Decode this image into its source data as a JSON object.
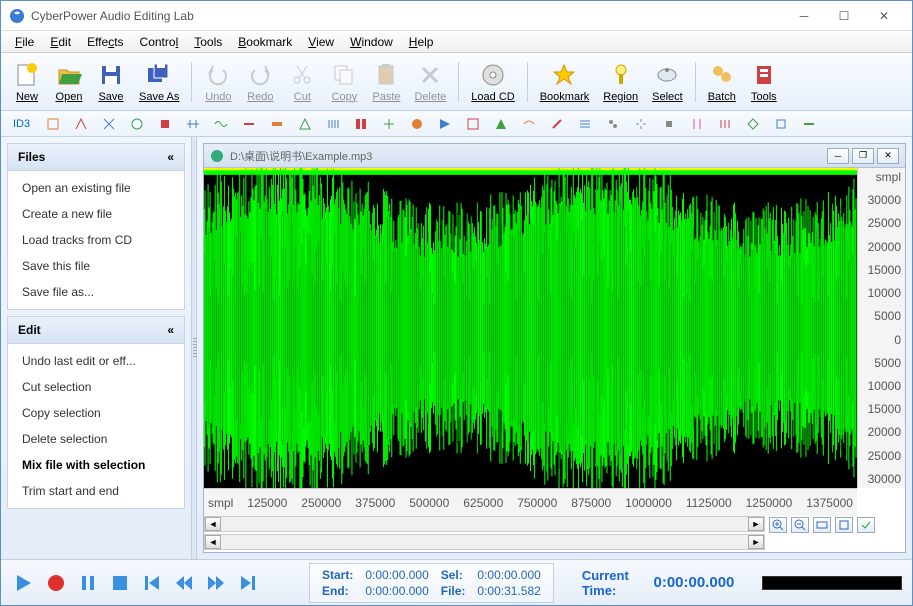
{
  "window": {
    "title": "CyberPower Audio Editing Lab"
  },
  "menu": {
    "items": [
      "File",
      "Edit",
      "Effects",
      "Control",
      "Tools",
      "Bookmark",
      "View",
      "Window",
      "Help"
    ]
  },
  "toolbar": [
    {
      "label": "New",
      "icon": "new",
      "enabled": true
    },
    {
      "label": "Open",
      "icon": "open",
      "enabled": true
    },
    {
      "label": "Save",
      "icon": "save",
      "enabled": true
    },
    {
      "label": "Save As",
      "icon": "saveas",
      "enabled": true
    },
    {
      "sep": true
    },
    {
      "label": "Undo",
      "icon": "undo",
      "enabled": false
    },
    {
      "label": "Redo",
      "icon": "redo",
      "enabled": false
    },
    {
      "label": "Cut",
      "icon": "cut",
      "enabled": false
    },
    {
      "label": "Copy",
      "icon": "copy",
      "enabled": false
    },
    {
      "label": "Paste",
      "icon": "paste",
      "enabled": false
    },
    {
      "label": "Delete",
      "icon": "delete",
      "enabled": false
    },
    {
      "sep": true
    },
    {
      "label": "Load CD",
      "icon": "cd",
      "enabled": true
    },
    {
      "sep": true
    },
    {
      "label": "Bookmark",
      "icon": "bookmark",
      "enabled": true
    },
    {
      "label": "Region",
      "icon": "region",
      "enabled": true
    },
    {
      "label": "Select",
      "icon": "select",
      "enabled": true
    },
    {
      "sep": true
    },
    {
      "label": "Batch",
      "icon": "batch",
      "enabled": true
    },
    {
      "label": "Tools",
      "icon": "tools",
      "enabled": true
    }
  ],
  "id3_label": "ID3",
  "sidebar": {
    "files": {
      "title": "Files",
      "items": [
        "Open an existing file",
        "Create a new file",
        "Load tracks from CD",
        "Save this file",
        "Save file as..."
      ]
    },
    "edit": {
      "title": "Edit",
      "items": [
        "Undo last edit or eff...",
        "Cut selection",
        "Copy selection",
        "Delete selection",
        "Mix file with selection",
        "Trim start and end"
      ],
      "bold_index": 4
    }
  },
  "document": {
    "path": "D:\\桌面\\说明书\\Example.mp3",
    "y_unit": "smpl",
    "y_ticks": [
      "30000",
      "25000",
      "20000",
      "15000",
      "10000",
      "5000",
      "0",
      "5000",
      "10000",
      "15000",
      "20000",
      "25000",
      "30000"
    ],
    "x_unit": "smpl",
    "x_ticks": [
      "125000",
      "250000",
      "375000",
      "500000",
      "625000",
      "750000",
      "875000",
      "1000000",
      "1125000",
      "1250000",
      "1375000"
    ]
  },
  "status": {
    "start_label": "Start:",
    "start": "0:00:00.000",
    "end_label": "End:",
    "end": "0:00:00.000",
    "sel_label": "Sel:",
    "sel": "0:00:00.000",
    "file_label": "File:",
    "file": "0:00:31.582",
    "current_label": "Current Time:",
    "current": "0:00:00.000"
  },
  "chart_data": {
    "type": "waveform",
    "title": "Audio waveform (single channel)",
    "x_unit": "samples",
    "x_range": [
      0,
      1400000
    ],
    "y_unit": "sample amplitude",
    "y_range": [
      -32000,
      32000
    ],
    "peak_amplitude": 31000,
    "typical_amplitude": 18000,
    "duration_seconds": 31.582,
    "note": "Dense full-width green waveform filling most of the amplitude range; individual sample values not readable at this zoom."
  }
}
